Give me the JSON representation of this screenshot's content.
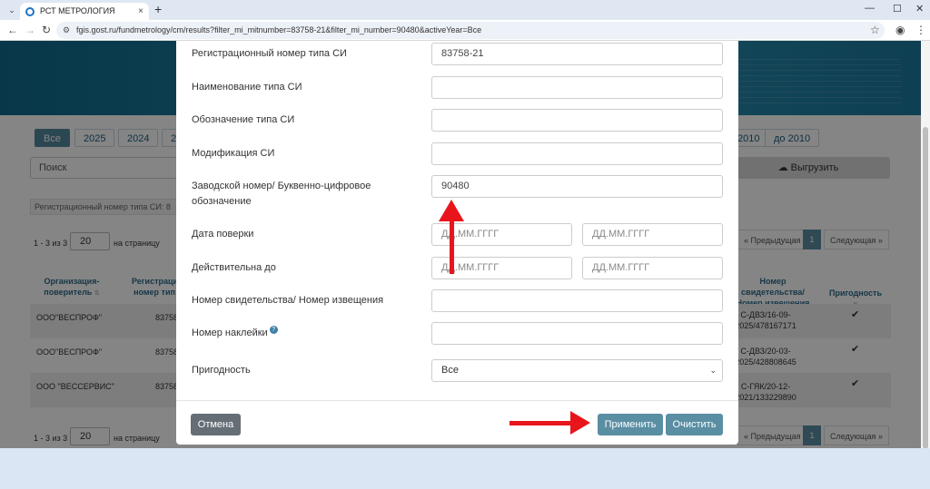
{
  "browser": {
    "tab_title": "РСТ МЕТРОЛОГИЯ",
    "tab_close": "×",
    "new_tab": "+",
    "url": "fgis.gost.ru/fundmetrology/cm/results?filter_mi_mitnumber=83758-21&filter_mi_number=90480&activeYear=Все",
    "win_min": "—",
    "win_max": "☐",
    "win_close": "✕"
  },
  "background": {
    "year_tabs": [
      "Все",
      "2025",
      "2024",
      "2",
      "2010",
      "до 2010"
    ],
    "search_placeholder": "Поиск",
    "export_label": "Выгрузить",
    "filter_chip": "Регистрационный номер типа СИ: 8",
    "count_text": "1 - 3 из 3",
    "per_page_value": "20",
    "per_page_label": "на страницу",
    "prev_label": "« Предыдущая",
    "current_page": "1",
    "next_label": "Следующая »",
    "headers": {
      "org": "Организация-поверитель",
      "reg": "Регистраци номер тип",
      "cert": "Номер свидетельства/ Номер извещения",
      "valid": "Пригодность"
    },
    "rows": [
      {
        "org": "ООО\"ВЕСПРОФ\"",
        "reg": "83758",
        "cert": "С-ДВЗ/16-09-2025/478167171"
      },
      {
        "org": "ООО\"ВЕСПРОФ\"",
        "reg": "83758",
        "cert": "С-ДВЗ/20-03-2025/428808645"
      },
      {
        "org": "ООО \"ВЕССЕРВИС\"",
        "reg": "83758",
        "cert": "С-ГЯК/20-12-2021/133229890"
      }
    ]
  },
  "modal": {
    "fields": {
      "reg_number": {
        "label": "Регистрационный номер типа СИ",
        "value": "83758-21"
      },
      "type_name": {
        "label": "Наименование типа СИ",
        "value": ""
      },
      "type_designation": {
        "label": "Обозначение типа СИ",
        "value": ""
      },
      "modification": {
        "label": "Модификация СИ",
        "value": ""
      },
      "serial_number": {
        "label": "Заводской номер/ Буквенно-цифровое обозначение",
        "value": "90480"
      },
      "verification_date": {
        "label": "Дата поверки",
        "from_placeholder": "ДД.ММ.ГГГГ",
        "to_placeholder": "ДД.ММ.ГГГГ"
      },
      "valid_until": {
        "label": "Действительна до",
        "from_placeholder": "ДД.ММ.ГГГГ",
        "to_placeholder": "ДД.ММ.ГГГГ"
      },
      "certificate_number": {
        "label": "Номер свидетельства/ Номер извещения",
        "value": ""
      },
      "sticker_number": {
        "label": "Номер наклейки",
        "value": ""
      },
      "suitability": {
        "label": "Пригодность",
        "selected": "Все"
      }
    },
    "cancel_label": "Отмена",
    "apply_label": "Применить",
    "clear_label": "Очистить"
  },
  "colors": {
    "accent": "#5a8ea3",
    "arrow": "#e8161c"
  }
}
